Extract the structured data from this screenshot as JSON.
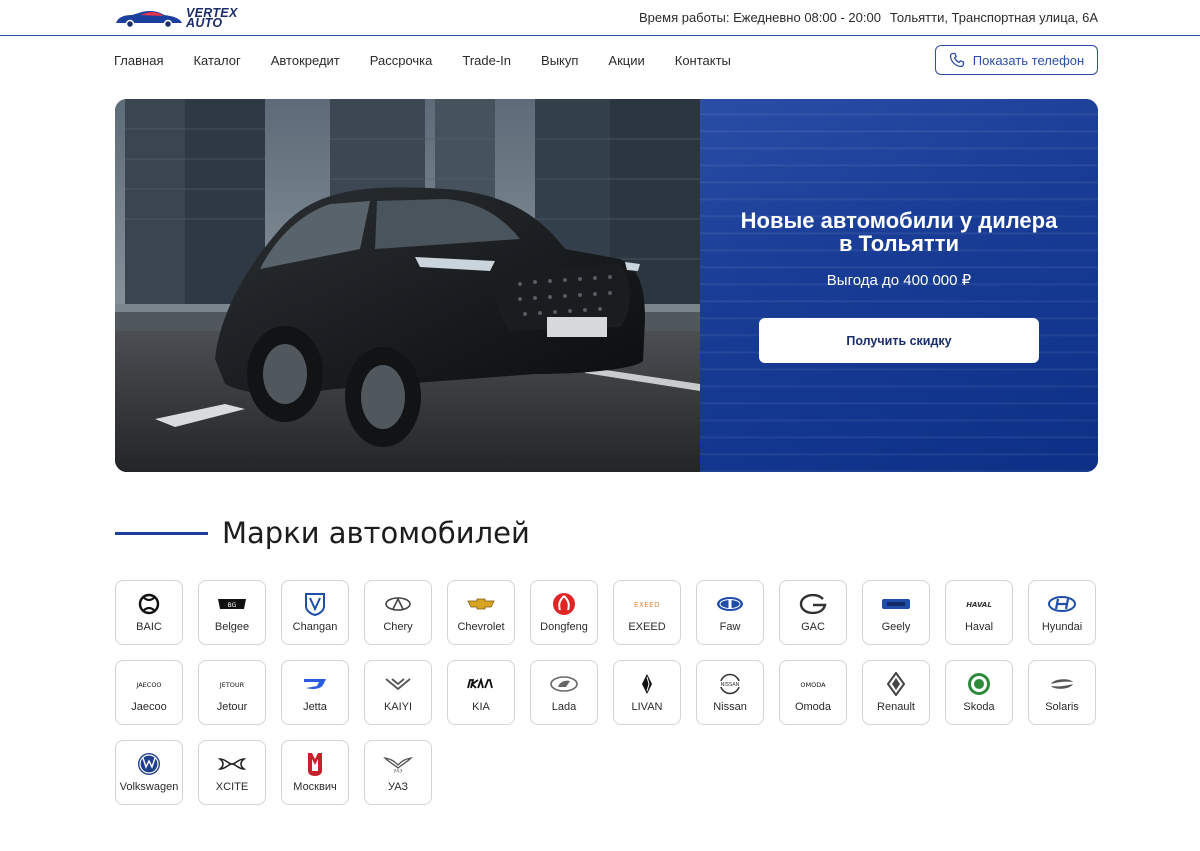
{
  "header": {
    "logo_line1": "VERTEX",
    "logo_line2": "AUTO",
    "hours": "Время работы: Ежедневно 08:00 - 20:00",
    "address": "Тольятти, Транспортная улица, 6А"
  },
  "nav": {
    "items": [
      "Главная",
      "Каталог",
      "Автокредит",
      "Рассрочка",
      "Trade-In",
      "Выкуп",
      "Акции",
      "Контакты"
    ],
    "phone_button": "Показать телефон"
  },
  "hero": {
    "title": "Новые автомобили у дилера в Тольятти",
    "subtitle": "Выгода до 400 000 ₽",
    "button": "Получить скидку"
  },
  "brands_section": {
    "title": "Марки автомобилей",
    "brands": [
      {
        "name": "BAIC",
        "icon": "baic-logo-icon"
      },
      {
        "name": "Belgee",
        "icon": "belgee-logo-icon"
      },
      {
        "name": "Changan",
        "icon": "changan-logo-icon"
      },
      {
        "name": "Chery",
        "icon": "chery-logo-icon"
      },
      {
        "name": "Chevrolet",
        "icon": "chevrolet-logo-icon"
      },
      {
        "name": "Dongfeng",
        "icon": "dongfeng-logo-icon"
      },
      {
        "name": "EXEED",
        "icon": "exeed-logo-icon"
      },
      {
        "name": "Faw",
        "icon": "faw-logo-icon"
      },
      {
        "name": "GAC",
        "icon": "gac-logo-icon"
      },
      {
        "name": "Geely",
        "icon": "geely-logo-icon"
      },
      {
        "name": "Haval",
        "icon": "haval-logo-icon"
      },
      {
        "name": "Hyundai",
        "icon": "hyundai-logo-icon"
      },
      {
        "name": "Jaecoo",
        "icon": "jaecoo-logo-icon"
      },
      {
        "name": "Jetour",
        "icon": "jetour-logo-icon"
      },
      {
        "name": "Jetta",
        "icon": "jetta-logo-icon"
      },
      {
        "name": "KAIYI",
        "icon": "kaiyi-logo-icon"
      },
      {
        "name": "KIA",
        "icon": "kia-logo-icon"
      },
      {
        "name": "Lada",
        "icon": "lada-logo-icon"
      },
      {
        "name": "LIVAN",
        "icon": "livan-logo-icon"
      },
      {
        "name": "Nissan",
        "icon": "nissan-logo-icon"
      },
      {
        "name": "Omoda",
        "icon": "omoda-logo-icon"
      },
      {
        "name": "Renault",
        "icon": "renault-logo-icon"
      },
      {
        "name": "Skoda",
        "icon": "skoda-logo-icon"
      },
      {
        "name": "Solaris",
        "icon": "solaris-logo-icon"
      },
      {
        "name": "Volkswagen",
        "icon": "volkswagen-logo-icon"
      },
      {
        "name": "XCITE",
        "icon": "xcite-logo-icon"
      },
      {
        "name": "Москвич",
        "icon": "moskvich-logo-icon"
      },
      {
        "name": "УАЗ",
        "icon": "uaz-logo-icon"
      }
    ]
  },
  "colors": {
    "accent": "#2a4fa8",
    "brand_dark": "#1c2d6b",
    "hero_blue": "#0d2f86"
  }
}
